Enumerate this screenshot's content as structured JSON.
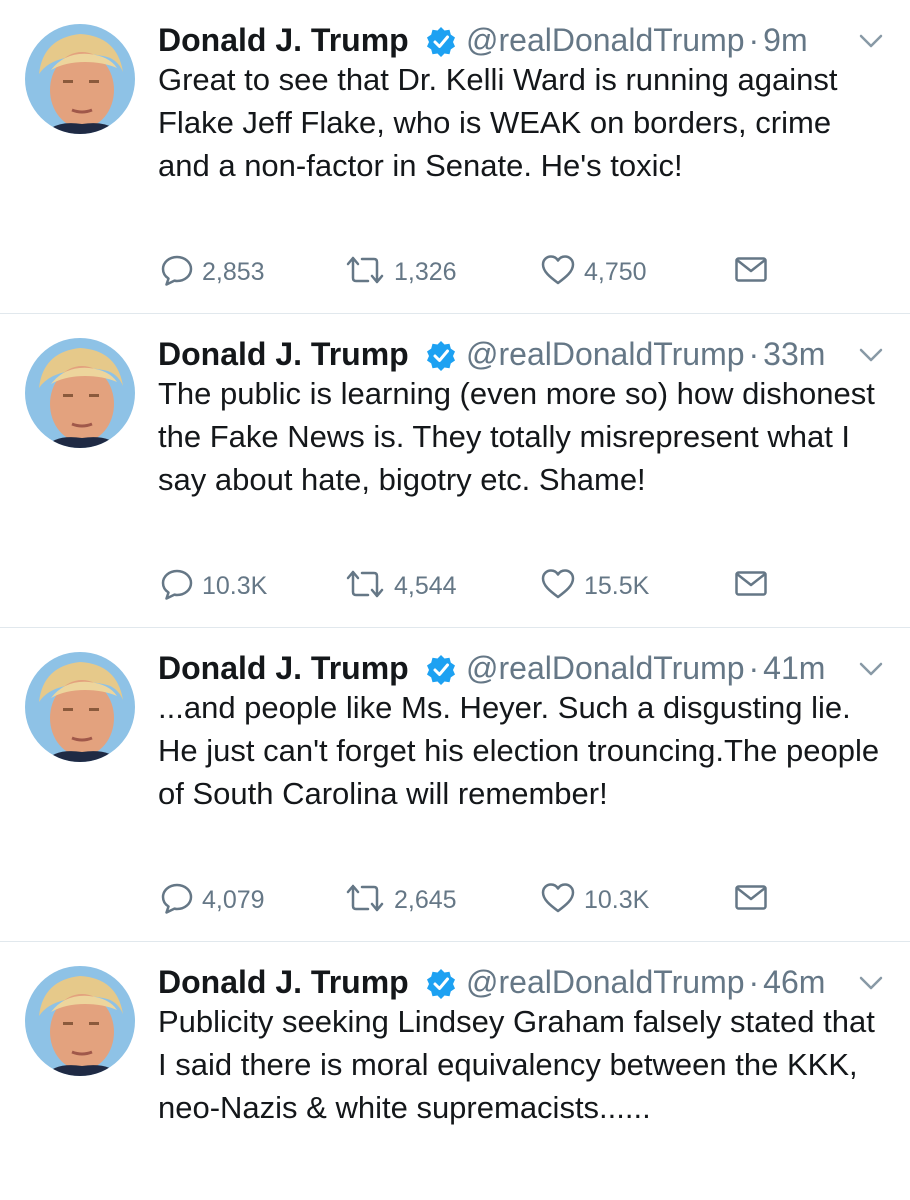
{
  "colors": {
    "verified_blue": "#1da1f2",
    "meta_gray": "#657786",
    "text_dark": "#14171a",
    "divider": "#e1e8ed"
  },
  "icons": {
    "reply": "reply-icon",
    "retweet": "retweet-icon",
    "like": "heart-icon",
    "dm": "envelope-icon",
    "verified": "verified-badge-icon",
    "menu": "chevron-down-icon"
  },
  "tweets": [
    {
      "name": "Donald J. Trump",
      "handle": "@realDonaldTrump",
      "separator": "·",
      "time": "9m",
      "text": "Great to see that Dr. Kelli Ward is running against Flake Jeff Flake, who is WEAK on borders, crime and a non-factor in Senate. He's toxic!",
      "replies": "2,853",
      "retweets": "1,326",
      "likes": "4,750"
    },
    {
      "name": "Donald J. Trump",
      "handle": "@realDonaldTrump",
      "separator": "·",
      "time": "33m",
      "text": "The public is learning (even more so) how dishonest the Fake News is. They totally misrepresent what I say about hate, bigotry etc. Shame!",
      "replies": "10.3K",
      "retweets": "4,544",
      "likes": "15.5K"
    },
    {
      "name": "Donald J. Trump",
      "handle": "@realDonaldTrump",
      "separator": "·",
      "time": "41m",
      "text": "...and people like Ms. Heyer. Such a disgusting lie. He just can't forget his election trouncing.The people of South Carolina will remember!",
      "replies": "4,079",
      "retweets": "2,645",
      "likes": "10.3K"
    },
    {
      "name": "Donald J. Trump",
      "handle": "@realDonaldTrump",
      "separator": "·",
      "time": "46m",
      "text": "Publicity seeking Lindsey Graham falsely stated that I said there is moral equivalency between the KKK, neo-Nazis & white supremacists......"
    }
  ]
}
